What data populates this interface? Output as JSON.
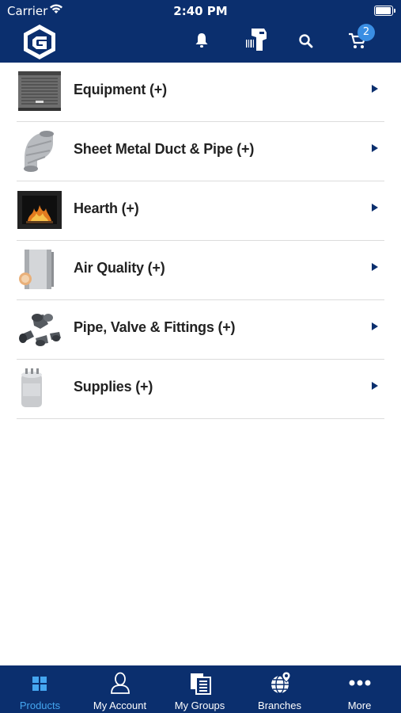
{
  "status_bar": {
    "carrier": "Carrier",
    "time": "2:40 PM",
    "battery_level": 0.95
  },
  "header": {
    "logo_icon": "g-shield-logo",
    "icons": [
      "bell-icon",
      "barcode-scanner-icon",
      "search-icon",
      "cart-icon"
    ],
    "cart_count": "2"
  },
  "categories": [
    {
      "label": "Equipment (+)",
      "thumbnail": "condenser-unit-image"
    },
    {
      "label": "Sheet Metal Duct & Pipe (+)",
      "thumbnail": "duct-elbow-image"
    },
    {
      "label": "Hearth (+)",
      "thumbnail": "fireplace-image"
    },
    {
      "label": "Air Quality (+)",
      "thumbnail": "air-filter-image"
    },
    {
      "label": "Pipe, Valve & Fittings (+)",
      "thumbnail": "pipe-fittings-image"
    },
    {
      "label": "Supplies (+)",
      "thumbnail": "capacitor-image"
    }
  ],
  "tabs": [
    {
      "label": "Products",
      "icon": "grid-icon",
      "active": true
    },
    {
      "label": "My Account",
      "icon": "person-icon",
      "active": false
    },
    {
      "label": "My Groups",
      "icon": "documents-icon",
      "active": false
    },
    {
      "label": "Branches",
      "icon": "globe-pin-icon",
      "active": false
    },
    {
      "label": "More",
      "icon": "more-dots-icon",
      "active": false
    }
  ],
  "colors": {
    "navy": "#0b2f6e",
    "accent_blue": "#45a6f0",
    "badge_blue": "#3a8ee3"
  }
}
